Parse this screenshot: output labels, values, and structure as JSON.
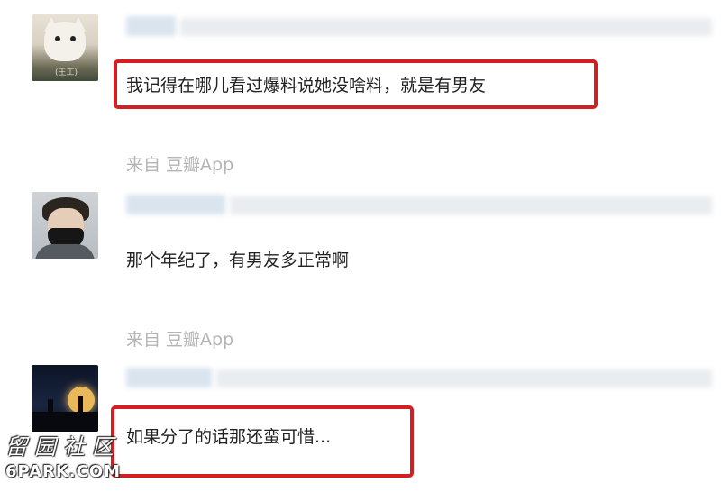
{
  "comments": [
    {
      "text": "我记得在哪儿看过爆料说她没啥料，就是有男友",
      "source": "来自 豆瓣App"
    },
    {
      "text": "那个年纪了，有男友多正常啊",
      "source": "来自 豆瓣App"
    },
    {
      "text": "如果分了的话那还蛮可惜..."
    }
  ],
  "colors": {
    "highlight": "#d21f22",
    "source_text": "#b4b4b4",
    "body_text": "#222222"
  },
  "watermark": {
    "line1": "留园社区",
    "line2": "6PARK.COM"
  }
}
